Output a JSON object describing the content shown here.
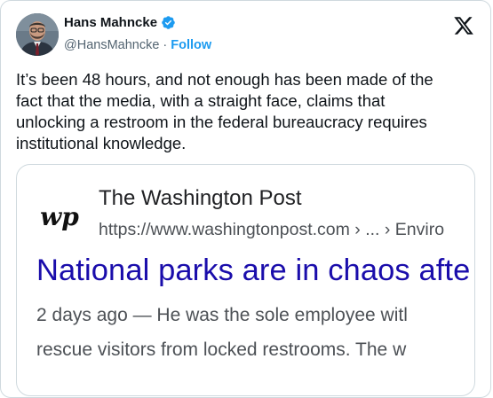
{
  "author": {
    "name": "Hans Mahncke",
    "handle": "@HansMahncke",
    "separator": "·",
    "follow_label": "Follow"
  },
  "icons": {
    "verified": "verified-badge-icon",
    "platform": "x-logo-icon",
    "accent_color": "#1d9bf0"
  },
  "tweet": {
    "lines": [
      "It’s been 48 hours, and not enough has been made of the",
      "fact that the media, with a straight face, claims that",
      "unlocking a restroom in the federal bureaucracy requires",
      "institutional knowledge."
    ]
  },
  "media": {
    "site_name": "The Washington Post",
    "site_url": "https://www.washingtonpost.com › ... › Enviro",
    "headline": "National parks are in chaos afte",
    "headline_color": "#1a0dab",
    "snippet_line1": "2 days ago — He was the sole employee witl",
    "snippet_line2": "rescue visitors from locked restrooms. The w"
  }
}
